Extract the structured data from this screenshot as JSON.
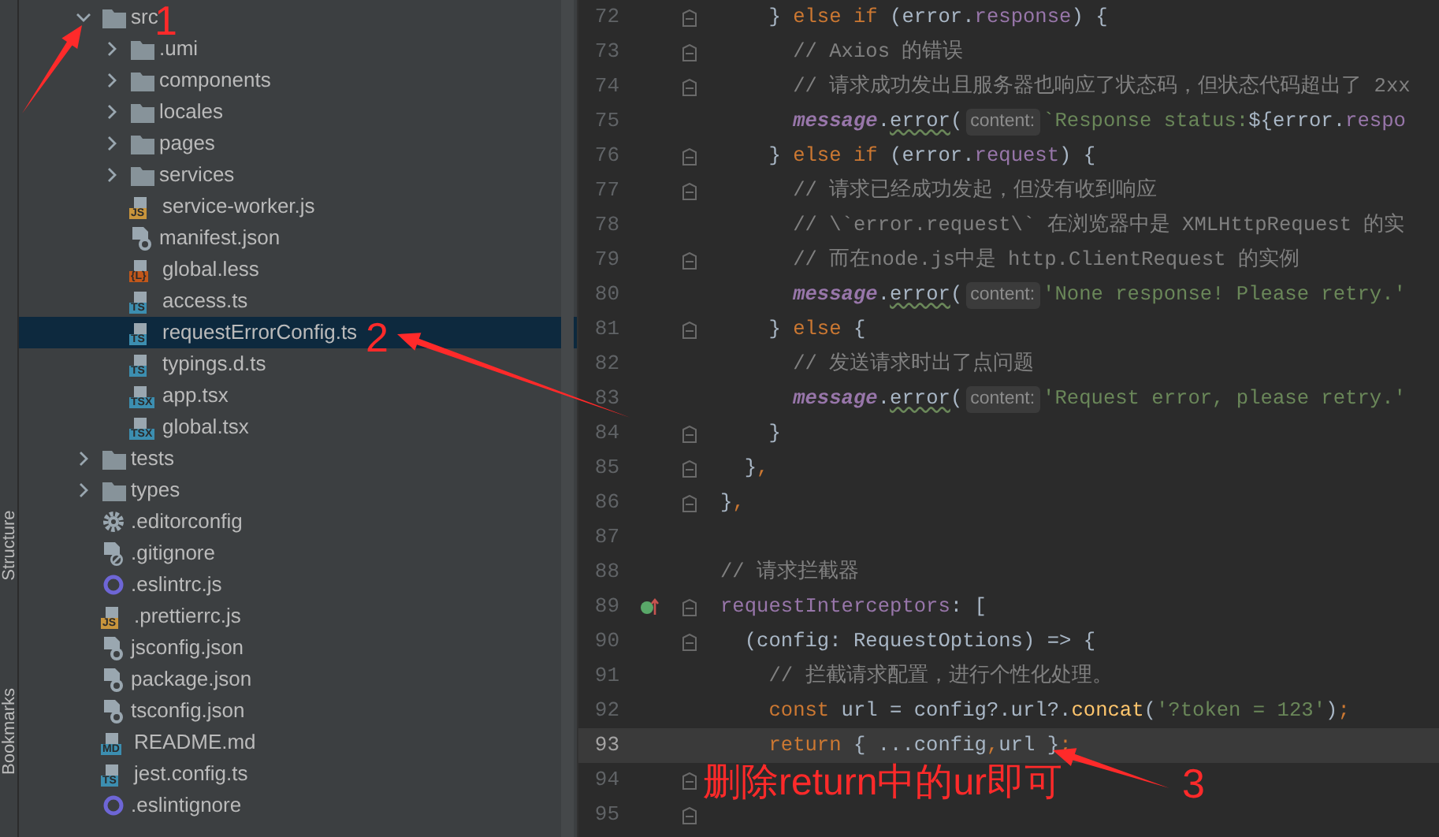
{
  "side_strip": {
    "tabs": [
      {
        "label": "Structure"
      },
      {
        "label": "Bookmarks"
      }
    ]
  },
  "project_tree": [
    {
      "label": "src",
      "kind": "folder",
      "expanded": true,
      "selected": false,
      "children": [
        {
          "label": ".umi",
          "kind": "folder",
          "expanded": false,
          "selected": false
        },
        {
          "label": "components",
          "kind": "folder",
          "expanded": false,
          "selected": false
        },
        {
          "label": "locales",
          "kind": "folder",
          "expanded": false,
          "selected": false
        },
        {
          "label": "pages",
          "kind": "folder",
          "expanded": false,
          "selected": false
        },
        {
          "label": "services",
          "kind": "folder",
          "expanded": false,
          "selected": false
        },
        {
          "label": "service-worker.js",
          "kind": "badge",
          "badge": "JS",
          "color": "#c9953c",
          "selected": false
        },
        {
          "label": "manifest.json",
          "kind": "json",
          "selected": false
        },
        {
          "label": "global.less",
          "kind": "badge",
          "badge": "{L}",
          "color": "#c2571a",
          "selected": false
        },
        {
          "label": "access.ts",
          "kind": "badge",
          "badge": "TS",
          "color": "#3c8eb0",
          "selected": false
        },
        {
          "label": "requestErrorConfig.ts",
          "kind": "badge",
          "badge": "TS",
          "color": "#3c8eb0",
          "selected": true
        },
        {
          "label": "typings.d.ts",
          "kind": "badge",
          "badge": "TS",
          "color": "#3c8eb0",
          "selected": false
        },
        {
          "label": "app.tsx",
          "kind": "badge",
          "badge": "TSX",
          "color": "#3c8eb0",
          "selected": false
        },
        {
          "label": "global.tsx",
          "kind": "badge",
          "badge": "TSX",
          "color": "#3c8eb0",
          "selected": false
        }
      ]
    },
    {
      "label": "tests",
      "kind": "folder",
      "expanded": false,
      "selected": false
    },
    {
      "label": "types",
      "kind": "folder",
      "expanded": false,
      "selected": false
    },
    {
      "label": ".editorconfig",
      "kind": "gear",
      "selected": false
    },
    {
      "label": ".gitignore",
      "kind": "ignored",
      "selected": false
    },
    {
      "label": ".eslintrc.js",
      "kind": "ring",
      "selected": false
    },
    {
      "label": ".prettierrc.js",
      "kind": "badge",
      "badge": "JS",
      "color": "#c9953c",
      "selected": false
    },
    {
      "label": "jsconfig.json",
      "kind": "json",
      "selected": false
    },
    {
      "label": "package.json",
      "kind": "json",
      "selected": false
    },
    {
      "label": "tsconfig.json",
      "kind": "json",
      "selected": false
    },
    {
      "label": "README.md",
      "kind": "badge",
      "badge": "MD",
      "color": "#3c8eb0",
      "selected": false
    },
    {
      "label": "jest.config.ts",
      "kind": "badge",
      "badge": "TS",
      "color": "#3c8eb0",
      "selected": false
    },
    {
      "label": ".eslintignore",
      "kind": "ring",
      "selected": false
    }
  ],
  "editor": {
    "lines": [
      {
        "number": "72",
        "fold": true,
        "current": false,
        "tokens": [
          {
            "kind": "plain",
            "text": "    } "
          },
          {
            "kind": "keyword",
            "text": "else if "
          },
          {
            "kind": "plain",
            "text": "(error."
          },
          {
            "kind": "field",
            "text": "response"
          },
          {
            "kind": "plain",
            "text": ") {"
          }
        ]
      },
      {
        "number": "73",
        "fold": true,
        "current": false,
        "tokens": [
          {
            "kind": "comment",
            "text": "      // Axios 的错误"
          }
        ]
      },
      {
        "number": "74",
        "fold": true,
        "current": false,
        "tokens": [
          {
            "kind": "comment",
            "text": "      // 请求成功发出且服务器也响应了状态码，但状态代码超出了 2xx"
          }
        ]
      },
      {
        "number": "75",
        "fold": false,
        "current": false,
        "tokens": [
          {
            "kind": "global",
            "text": "      message"
          },
          {
            "kind": "plain",
            "text": "."
          },
          {
            "kind": "call",
            "text": "error"
          },
          {
            "kind": "plain",
            "text": "("
          },
          {
            "kind": "hint",
            "text": "content:"
          },
          {
            "kind": "string",
            "text": "`Response status:"
          },
          {
            "kind": "plain",
            "text": "${error."
          },
          {
            "kind": "field",
            "text": "respo"
          }
        ]
      },
      {
        "number": "76",
        "fold": true,
        "current": false,
        "tokens": [
          {
            "kind": "plain",
            "text": "    } "
          },
          {
            "kind": "keyword",
            "text": "else if "
          },
          {
            "kind": "plain",
            "text": "(error."
          },
          {
            "kind": "field",
            "text": "request"
          },
          {
            "kind": "plain",
            "text": ") {"
          }
        ]
      },
      {
        "number": "77",
        "fold": true,
        "current": false,
        "tokens": [
          {
            "kind": "comment",
            "text": "      // 请求已经成功发起，但没有收到响应"
          }
        ]
      },
      {
        "number": "78",
        "fold": false,
        "current": false,
        "tokens": [
          {
            "kind": "comment",
            "text": "      // \\`error.request\\` 在浏览器中是 XMLHttpRequest 的实"
          }
        ]
      },
      {
        "number": "79",
        "fold": true,
        "current": false,
        "tokens": [
          {
            "kind": "comment",
            "text": "      // 而在node.js中是 http.ClientRequest 的实例"
          }
        ]
      },
      {
        "number": "80",
        "fold": false,
        "current": false,
        "tokens": [
          {
            "kind": "global",
            "text": "      message"
          },
          {
            "kind": "plain",
            "text": "."
          },
          {
            "kind": "call",
            "text": "error"
          },
          {
            "kind": "plain",
            "text": "("
          },
          {
            "kind": "hint",
            "text": "content:"
          },
          {
            "kind": "string",
            "text": "'None response! Please retry.'"
          }
        ]
      },
      {
        "number": "81",
        "fold": true,
        "current": false,
        "tokens": [
          {
            "kind": "plain",
            "text": "    } "
          },
          {
            "kind": "keyword",
            "text": "else "
          },
          {
            "kind": "plain",
            "text": "{"
          }
        ]
      },
      {
        "number": "82",
        "fold": false,
        "current": false,
        "tokens": [
          {
            "kind": "comment",
            "text": "      // 发送请求时出了点问题"
          }
        ]
      },
      {
        "number": "83",
        "fold": false,
        "current": false,
        "tokens": [
          {
            "kind": "global",
            "text": "      message"
          },
          {
            "kind": "plain",
            "text": "."
          },
          {
            "kind": "call",
            "text": "error"
          },
          {
            "kind": "plain",
            "text": "("
          },
          {
            "kind": "hint",
            "text": "content:"
          },
          {
            "kind": "string",
            "text": "'Request error, please retry.'"
          }
        ]
      },
      {
        "number": "84",
        "fold": true,
        "current": false,
        "tokens": [
          {
            "kind": "plain",
            "text": "    }"
          }
        ]
      },
      {
        "number": "85",
        "fold": true,
        "current": false,
        "tokens": [
          {
            "kind": "plain",
            "text": "  }"
          },
          {
            "kind": "keyword",
            "text": ","
          }
        ]
      },
      {
        "number": "86",
        "fold": true,
        "current": false,
        "tokens": [
          {
            "kind": "plain",
            "text": "}"
          },
          {
            "kind": "keyword",
            "text": ","
          }
        ]
      },
      {
        "number": "87",
        "fold": false,
        "current": false
      },
      {
        "number": "88",
        "fold": false,
        "current": false,
        "tokens": [
          {
            "kind": "comment",
            "text": "// 请求拦截器"
          }
        ]
      },
      {
        "number": "89",
        "fold": true,
        "current": false,
        "marker": true,
        "tokens": [
          {
            "kind": "field",
            "text": "requestInterceptors"
          },
          {
            "kind": "plain",
            "text": ": ["
          }
        ]
      },
      {
        "number": "90",
        "fold": true,
        "current": false,
        "tokens": [
          {
            "kind": "plain",
            "text": "  (config: RequestOptions) => {"
          }
        ]
      },
      {
        "number": "91",
        "fold": false,
        "current": false,
        "tokens": [
          {
            "kind": "comment",
            "text": "    // 拦截请求配置，进行个性化处理。"
          }
        ]
      },
      {
        "number": "92",
        "fold": false,
        "current": false,
        "tokens": [
          {
            "kind": "keyword",
            "text": "    const "
          },
          {
            "kind": "plain",
            "text": "url = config?.url?."
          },
          {
            "kind": "function",
            "text": "concat"
          },
          {
            "kind": "plain",
            "text": "("
          },
          {
            "kind": "string",
            "text": "'?token = 123'"
          },
          {
            "kind": "plain",
            "text": ")"
          },
          {
            "kind": "keyword",
            "text": ";"
          }
        ]
      },
      {
        "number": "93",
        "fold": false,
        "current": true,
        "tokens": [
          {
            "kind": "keyword",
            "text": "    return "
          },
          {
            "kind": "plain",
            "text": "{ ...config"
          },
          {
            "kind": "keyword",
            "text": ","
          },
          {
            "kind": "plain",
            "text": "url }"
          },
          {
            "kind": "keyword",
            "text": ";"
          }
        ]
      },
      {
        "number": "94",
        "fold": true,
        "current": false
      },
      {
        "number": "95",
        "fold": true,
        "current": false
      }
    ]
  },
  "annotations": {
    "numbers": [
      "1",
      "2",
      "3"
    ],
    "note": "删除return中的ur即可"
  }
}
